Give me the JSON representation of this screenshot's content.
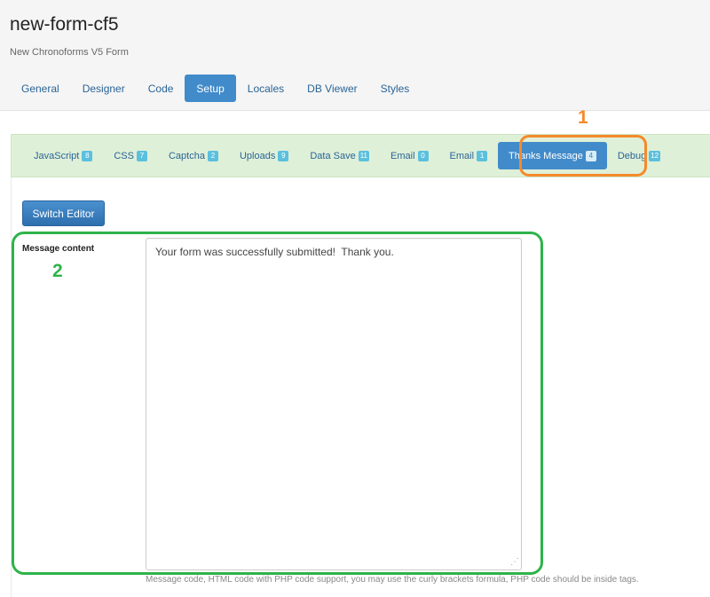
{
  "header": {
    "title": "new-form-cf5",
    "subtitle": "New Chronoforms V5 Form"
  },
  "main_tabs": [
    {
      "label": "General"
    },
    {
      "label": "Designer"
    },
    {
      "label": "Code"
    },
    {
      "label": "Setup",
      "active": true
    },
    {
      "label": "Locales"
    },
    {
      "label": "DB Viewer"
    },
    {
      "label": "Styles"
    }
  ],
  "sub_tabs": [
    {
      "label": "JavaScript",
      "badge": "8"
    },
    {
      "label": "CSS",
      "badge": "7"
    },
    {
      "label": "Captcha",
      "badge": "2"
    },
    {
      "label": "Uploads",
      "badge": "9"
    },
    {
      "label": "Data Save",
      "badge": "11"
    },
    {
      "label": "Email",
      "badge": "0"
    },
    {
      "label": "Email",
      "badge": "1"
    },
    {
      "label": "Thanks Message",
      "badge": "4",
      "active": true
    },
    {
      "label": "Debug",
      "badge": "12"
    }
  ],
  "editor": {
    "switch_label": "Switch Editor",
    "field_label": "Message content",
    "message_value": "Your form was successfully submitted!  Thank you.",
    "help": "Message code, HTML code with PHP code support, you may use the curly brackets formula, PHP code should be inside tags."
  },
  "annotations": {
    "marker_1": "1",
    "marker_2": "2",
    "color_1": "#f58a2a",
    "color_2": "#2eb34a"
  },
  "colors": {
    "accent": "#428bca",
    "subnav_bg": "#dff0d8",
    "badge": "#5bc0de"
  }
}
